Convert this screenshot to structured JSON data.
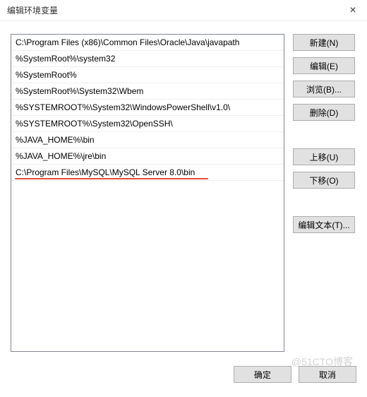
{
  "title": "编辑环境变量",
  "entries": [
    {
      "path": "C:\\Program Files (x86)\\Common Files\\Oracle\\Java\\javapath",
      "highlighted": false
    },
    {
      "path": "%SystemRoot%\\system32",
      "highlighted": false
    },
    {
      "path": "%SystemRoot%",
      "highlighted": false
    },
    {
      "path": "%SystemRoot%\\System32\\Wbem",
      "highlighted": false
    },
    {
      "path": "%SYSTEMROOT%\\System32\\WindowsPowerShell\\v1.0\\",
      "highlighted": false
    },
    {
      "path": "%SYSTEMROOT%\\System32\\OpenSSH\\",
      "highlighted": false
    },
    {
      "path": "%JAVA_HOME%\\bin",
      "highlighted": false
    },
    {
      "path": "%JAVA_HOME%\\jre\\bin",
      "highlighted": false
    },
    {
      "path": "C:\\Program Files\\MySQL\\MySQL Server 8.0\\bin",
      "highlighted": true,
      "underline_width": 274
    }
  ],
  "buttons": {
    "new": "新建(N)",
    "edit": "编辑(E)",
    "browse": "浏览(B)...",
    "delete": "删除(D)",
    "move_up": "上移(U)",
    "move_down": "下移(O)",
    "edit_text": "编辑文本(T)...",
    "ok": "确定",
    "cancel": "取消"
  },
  "watermark": "@51CTO博客"
}
